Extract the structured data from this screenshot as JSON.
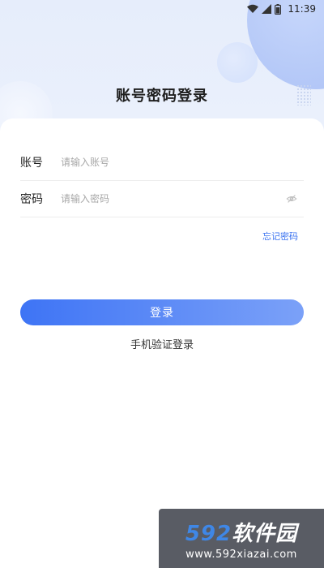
{
  "status_bar": {
    "time": "11:39"
  },
  "page": {
    "title": "账号密码登录"
  },
  "form": {
    "account": {
      "label": "账号",
      "placeholder": "请输入账号",
      "value": ""
    },
    "password": {
      "label": "密码",
      "placeholder": "请输入密码",
      "value": ""
    },
    "forgot_label": "忘记密码"
  },
  "actions": {
    "login_label": "登录",
    "sms_login_label": "手机验证登录"
  },
  "watermark": {
    "digits": "592",
    "name": "软件园",
    "url": "www.592xiazai.com"
  },
  "icons": {
    "wifi": "wifi-icon",
    "signal": "signal-icon",
    "battery": "battery-icon",
    "eye": "eye-off-icon"
  },
  "colors": {
    "accent": "#3b73f0",
    "button_start": "#3e74f5",
    "button_end": "#7ba1f8",
    "background": "#e6edfb"
  }
}
